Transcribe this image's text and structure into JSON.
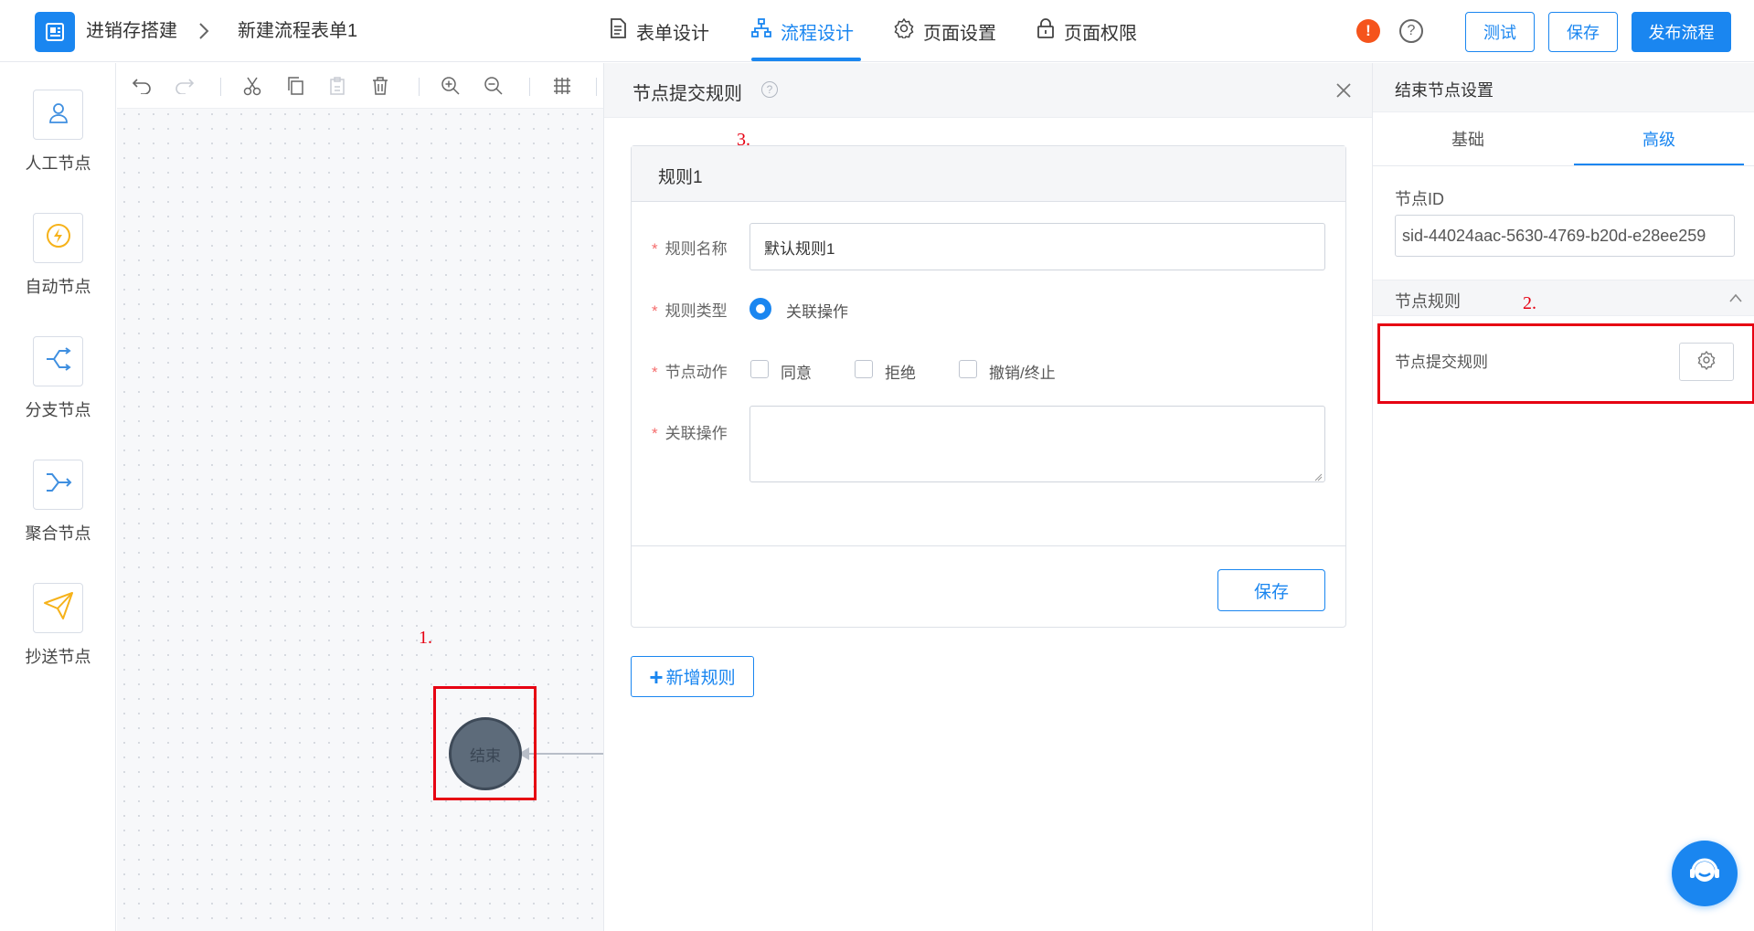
{
  "header": {
    "breadcrumb_app": "进销存搭建",
    "breadcrumb_page": "新建流程表单1",
    "tabs": [
      {
        "label": "表单设计",
        "icon": "document-icon"
      },
      {
        "label": "流程设计",
        "icon": "org-chart-icon",
        "active": true
      },
      {
        "label": "页面设置",
        "icon": "gear-icon"
      },
      {
        "label": "页面权限",
        "icon": "lock-icon"
      }
    ],
    "alert_badge": "!",
    "help_symbol": "?",
    "buttons": {
      "test": "测试",
      "save": "保存",
      "publish": "发布流程"
    }
  },
  "palette": {
    "items": [
      {
        "label": "人工节点",
        "icon": "user-icon"
      },
      {
        "label": "自动节点",
        "icon": "lightning-icon"
      },
      {
        "label": "分支节点",
        "icon": "branch-icon"
      },
      {
        "label": "聚合节点",
        "icon": "merge-icon"
      },
      {
        "label": "抄送节点",
        "icon": "paper-plane-icon"
      }
    ]
  },
  "canvas": {
    "end_node_label": "结束",
    "annotation": "1."
  },
  "rule_panel": {
    "title": "节点提交规则",
    "help_symbol": "?",
    "annotation": "3.",
    "rule": {
      "title": "规则1",
      "required_mark": "*",
      "fields": {
        "name_label": "规则名称",
        "name_value": "默认规则1",
        "type_label": "规则类型",
        "type_option": "关联操作",
        "action_label": "节点动作",
        "actions": [
          "同意",
          "拒绝",
          "撤销/终止"
        ],
        "related_label": "关联操作",
        "related_value": ""
      },
      "save_label": "保存"
    },
    "add_rule_label": "新增规则",
    "add_rule_symbol": "+"
  },
  "right_panel": {
    "title": "结束节点设置",
    "tabs": [
      {
        "label": "基础"
      },
      {
        "label": "高级",
        "active": true
      }
    ],
    "node_id_label": "节点ID",
    "node_id_value": "sid-44024aac-5630-4769-b20d-e28ee259",
    "section_title": "节点规则",
    "submit_rule_label": "节点提交规则",
    "annotation": "2."
  },
  "colors": {
    "accent": "#1a86f0",
    "annotation_red": "#e60012",
    "alert_orange": "#f5541c"
  }
}
